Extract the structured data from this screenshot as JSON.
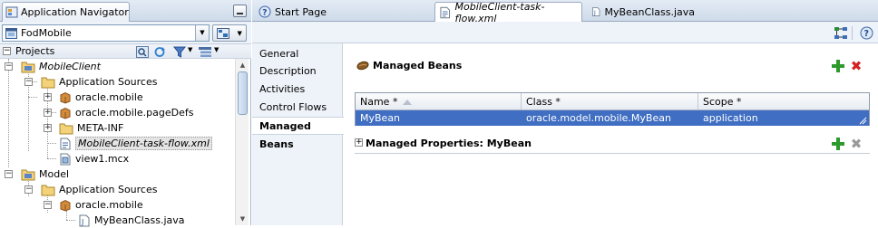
{
  "navigator": {
    "title": "Application Navigator",
    "application": "FodMobile",
    "projects_label": "Projects",
    "tree": [
      {
        "label": "MobileClient",
        "italic": true
      },
      {
        "label": "Application Sources"
      },
      {
        "label": "oracle.mobile"
      },
      {
        "label": "oracle.mobile.pageDefs"
      },
      {
        "label": "META-INF"
      },
      {
        "label": "MobileClient-task-flow.xml",
        "italic": true
      },
      {
        "label": "view1.mcx"
      },
      {
        "label": "Model"
      },
      {
        "label": "Application Sources"
      },
      {
        "label": "oracle.mobile"
      },
      {
        "label": "MyBeanClass.java"
      }
    ]
  },
  "editor": {
    "tabs": [
      {
        "label": "Start Page"
      },
      {
        "label": "MobileClient-task-flow.xml"
      },
      {
        "label": "MyBeanClass.java"
      }
    ],
    "side_nav": [
      "General",
      "Description",
      "Activities",
      "Control Flows",
      "Managed Beans"
    ],
    "managed_beans": {
      "title": "Managed Beans",
      "columns": [
        "Name *",
        "Class *",
        "Scope *"
      ],
      "rows": [
        {
          "name": "MyBean",
          "class": "oracle.model.mobile.MyBean",
          "scope": "application"
        }
      ]
    },
    "managed_properties": {
      "title": "Managed Properties: MyBean"
    }
  },
  "colors": {
    "selection": "#3f6ec2",
    "add_green": "#2d9a2d",
    "delete_red": "#d42020",
    "delete_disabled": "#9a9a9a"
  }
}
